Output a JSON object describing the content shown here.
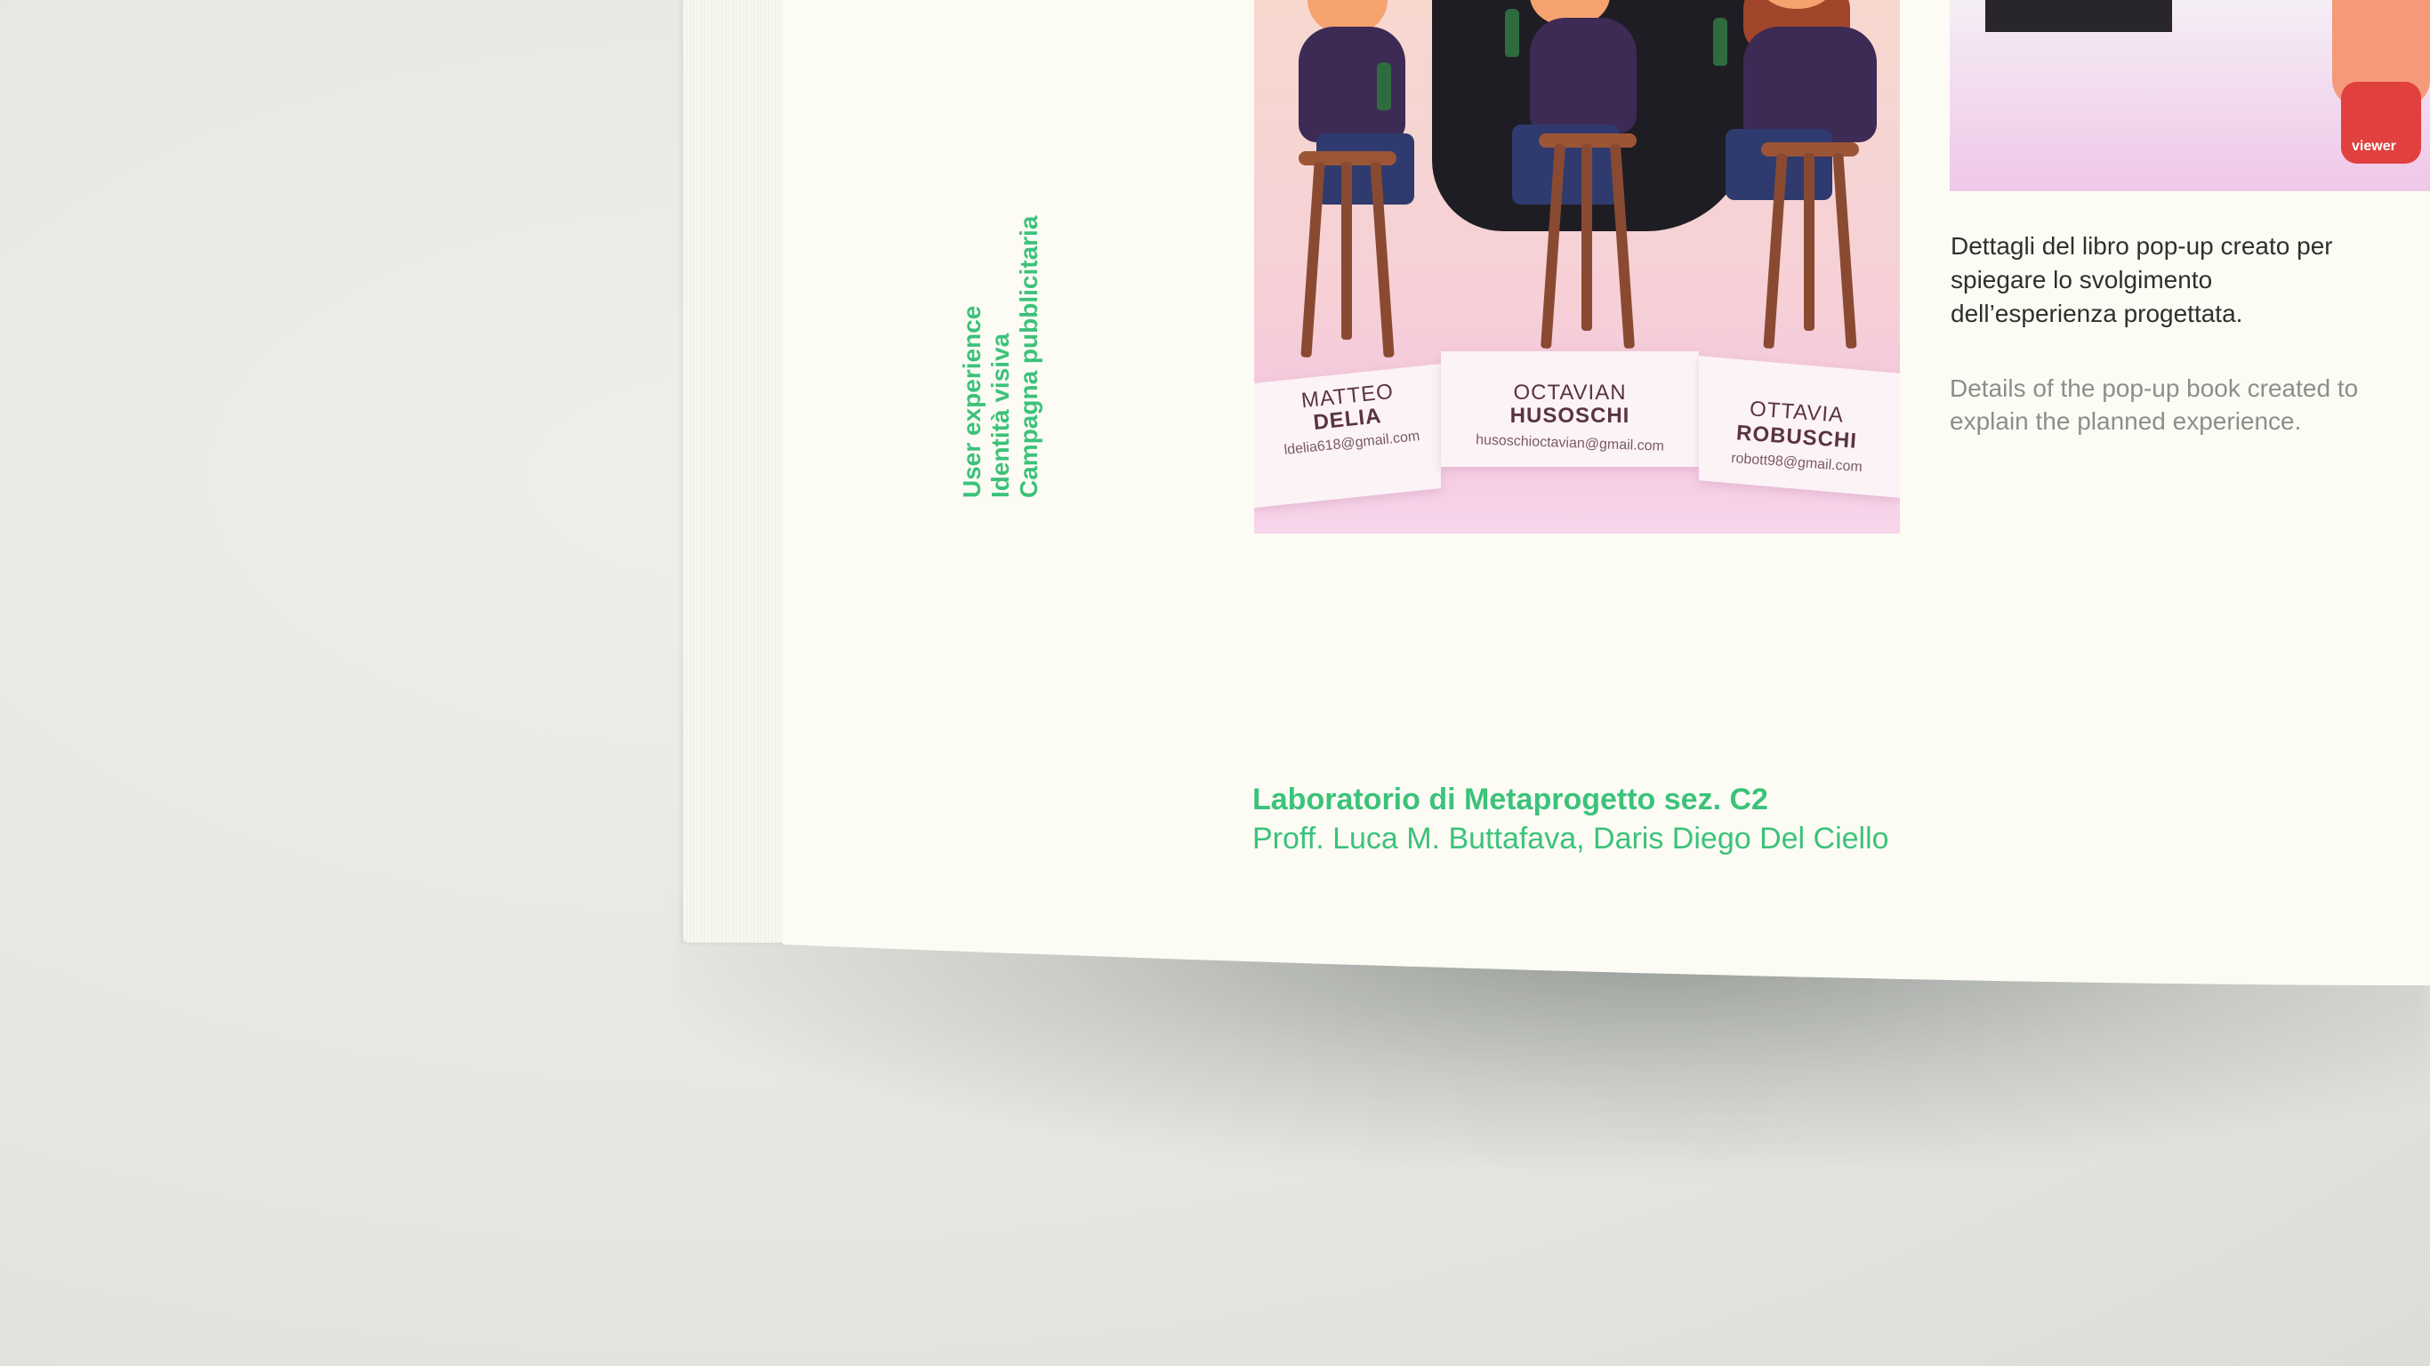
{
  "scene": {
    "background_color": "#e9e8e4",
    "page_color": "#fdfcf4",
    "accent_color": "#3cc27a"
  },
  "sidebar_tags": [
    "User experience",
    "Identità visiva",
    "Campagna pubblicitaria"
  ],
  "photo": {
    "people": [
      {
        "first": "MATTEO",
        "last": "DELIA",
        "email": "ldelia618@gmail.com"
      },
      {
        "first": "OCTAVIAN",
        "last": "HUSOSCHI",
        "email": "husoschioctavian@gmail.com"
      },
      {
        "first": "OTTAVIA",
        "last": "ROBUSCHI",
        "email": "robott98@gmail.com"
      }
    ],
    "viewer_label": "viewer"
  },
  "caption": {
    "italian": "Dettagli del libro pop-up creato per spiegare lo svolgimento dell’esperienza progettata.",
    "english": "Details of the pop-up book created to explain the planned experience."
  },
  "course": {
    "title": "Laboratorio di Metaprogetto sez. C2",
    "professors": "Proff. Luca M. Buttafava, Daris Diego Del Ciello"
  }
}
